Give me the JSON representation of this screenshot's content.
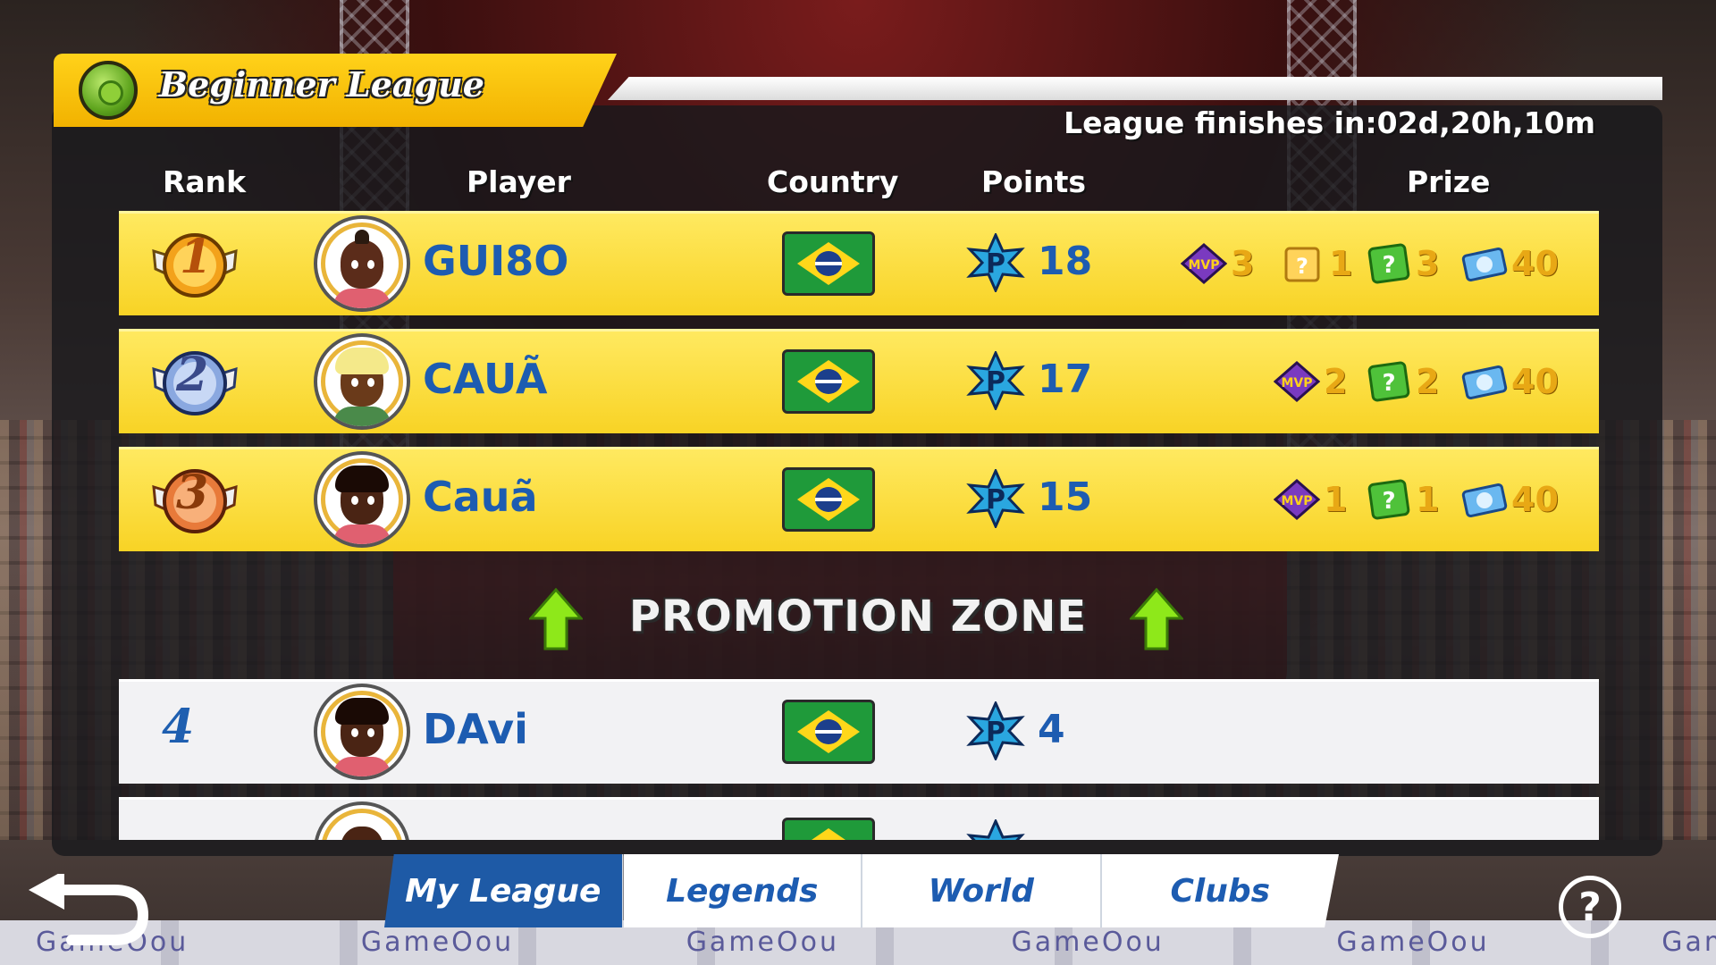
{
  "header": {
    "league_title": "Beginner League",
    "finish_text": "League finishes in:02d,20h,10m"
  },
  "columns": {
    "rank": "Rank",
    "player": "Player",
    "country": "Country",
    "points": "Points",
    "prize": "Prize"
  },
  "rows": [
    {
      "rank": "1",
      "player": "GUI8O",
      "points": "18",
      "prizes": {
        "mvp": "3",
        "box": "1",
        "mystery": "3",
        "coins": "40"
      }
    },
    {
      "rank": "2",
      "player": "CAUÃ",
      "points": "17",
      "prizes": {
        "mvp": "2",
        "mystery": "2",
        "coins": "40"
      }
    },
    {
      "rank": "3",
      "player": "Cauã",
      "points": "15",
      "prizes": {
        "mvp": "1",
        "mystery": "1",
        "coins": "40"
      }
    },
    {
      "rank": "4",
      "player": "DAvi",
      "points": "4"
    }
  ],
  "promotion_label": "PROMOTION ZONE",
  "tabs": {
    "my_league": "My League",
    "legends": "Legends",
    "world": "World",
    "clubs": "Clubs"
  },
  "help_label": "?",
  "ads": {
    "brand": "GameOou"
  },
  "colors": {
    "accent_yellow": "#f8d325",
    "accent_blue": "#1d5cb1",
    "tab_active": "#1e5aa6"
  }
}
